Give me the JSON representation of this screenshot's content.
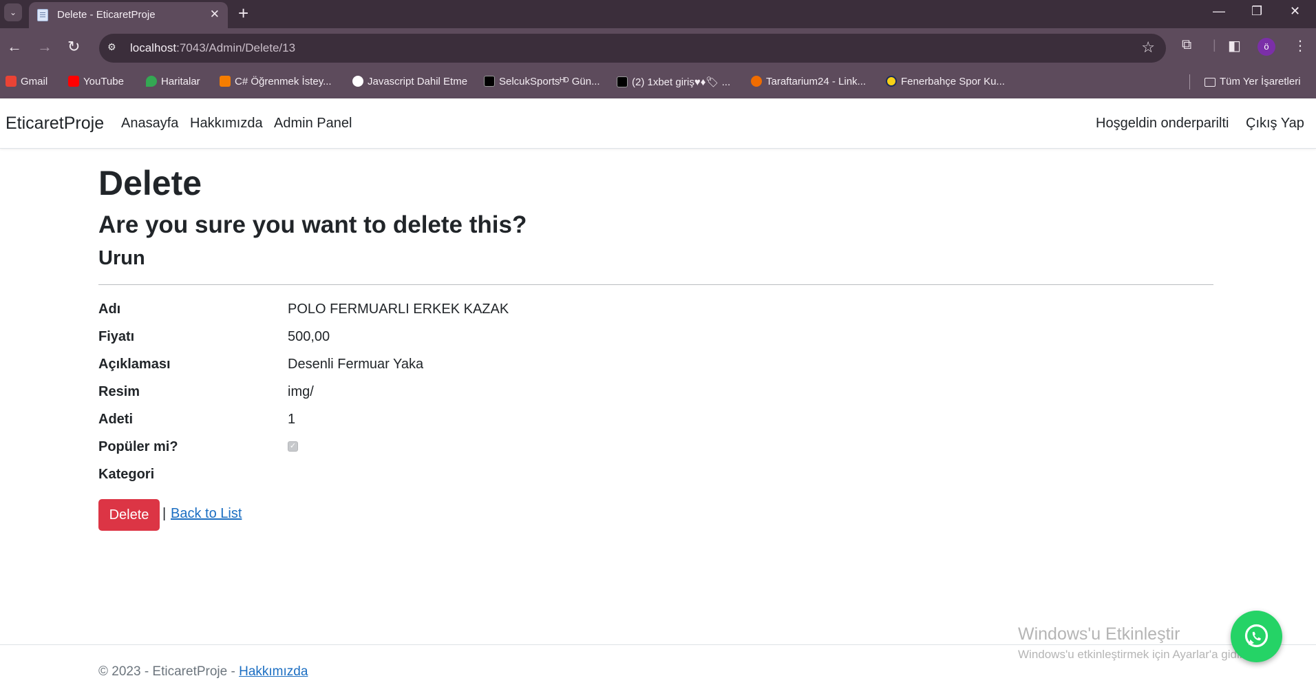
{
  "browser": {
    "tab_title": "Delete - EticaretProje",
    "url_host": "localhost",
    "url_path": ":7043/Admin/Delete/13",
    "profile_initial": "ö",
    "bookmarks": [
      {
        "label": "Gmail",
        "color": "#ea4335"
      },
      {
        "label": "YouTube",
        "color": "#ff0000"
      },
      {
        "label": "Haritalar",
        "color": "#34a853"
      },
      {
        "label": "C# Öğrenmek İstey...",
        "color": "#f57d00"
      },
      {
        "label": "Javascript Dahil Etme",
        "color": "#ffffff"
      },
      {
        "label": "SelcukSportsᴴᴰ Gün...",
        "color": "#000000"
      },
      {
        "label": "(2) 1xbet giriş♥♦🏷 ...",
        "color": "#000000"
      },
      {
        "label": "Taraftarium24 - Link...",
        "color": "#ef6c00"
      },
      {
        "label": "Fenerbahçe Spor Ku...",
        "color": "#f7d117"
      }
    ],
    "all_bookmarks_label": "Tüm Yer İşaretleri"
  },
  "nav": {
    "brand": "EticaretProje",
    "links": [
      "Anasayfa",
      "Hakkımızda",
      "Admin Panel"
    ],
    "greeting": "Hoşgeldin onderparilti",
    "logout": "Çıkış Yap"
  },
  "page": {
    "title": "Delete",
    "question": "Are you sure you want to delete this?",
    "entity": "Urun",
    "fields": [
      {
        "label": "Adı",
        "value": "POLO FERMUARLI ERKEK KAZAK"
      },
      {
        "label": "Fiyatı",
        "value": "500,00"
      },
      {
        "label": "Açıklaması",
        "value": "Desenli Fermuar Yaka"
      },
      {
        "label": "Resim",
        "value": "img/"
      },
      {
        "label": "Adeti",
        "value": "1"
      },
      {
        "label": "Popüler mi?",
        "value": ""
      },
      {
        "label": "Kategori",
        "value": ""
      }
    ],
    "populer_checked": true,
    "delete_button": "Delete",
    "separator": "|",
    "back_link": "Back to List"
  },
  "footer": {
    "text": "© 2023 - EticaretProje - ",
    "link": "Hakkımızda"
  },
  "watermark": {
    "title": "Windows'u Etkinleştir",
    "subtitle": "Windows'u etkinleştirmek için Ayarlar'a gidin."
  },
  "colors": {
    "danger": "#dc3545",
    "link": "#1b6ec2",
    "whatsapp": "#25d366"
  }
}
